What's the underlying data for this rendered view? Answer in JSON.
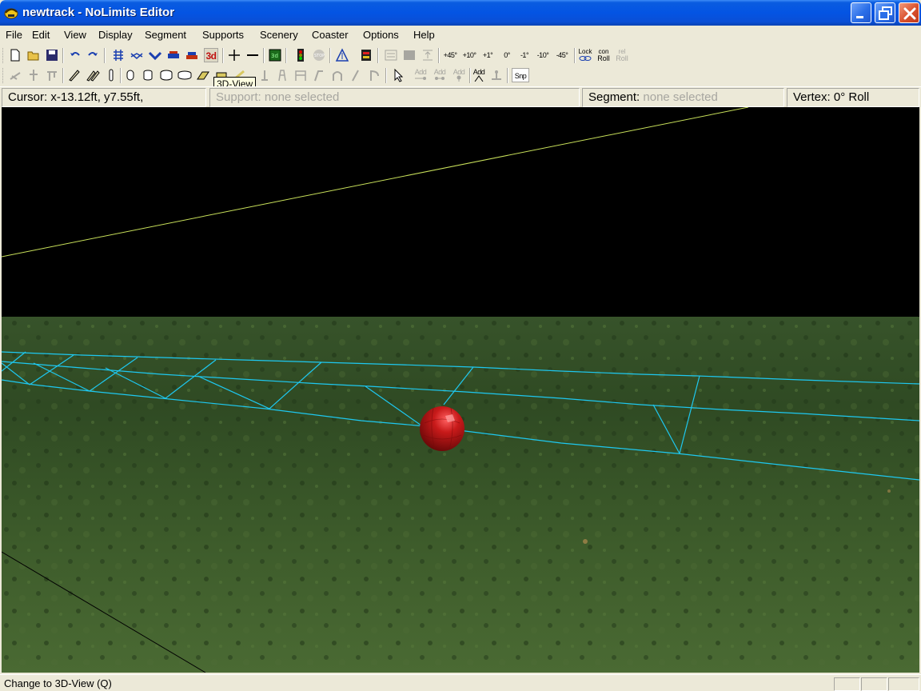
{
  "window": {
    "title": "newtrack - NoLimits Editor",
    "controls": [
      "minimize-icon",
      "maximize-icon",
      "close-icon"
    ]
  },
  "menu": {
    "items": [
      "File",
      "Edit",
      "View",
      "Display",
      "Segment",
      "Supports",
      "Scenery",
      "Coaster",
      "Options",
      "Help"
    ]
  },
  "toolbar": {
    "row1_text_buttons": {
      "plus45": "+45°",
      "plus10": "+10°",
      "plus1": "+1°",
      "zero": "0°",
      "minus1": "-1°",
      "minus10": "-10°",
      "minus45": "-45°",
      "lock_roll_top": "Lock",
      "lock_roll_bottom": "",
      "con_roll_top": "con",
      "con_roll_bottom": "Roll",
      "rel_roll_top": "rel",
      "rel_roll_bottom": "Roll",
      "three_d": "3d"
    },
    "row2_text_buttons": {
      "add1": "Add",
      "add2": "Add",
      "add3": "Add",
      "add4": "Add",
      "snap": "Snp"
    },
    "tooltip": "3D-View"
  },
  "infobar": {
    "cursor_label": "Cursor:",
    "cursor_value": "x-13.12ft, y7.55ft,",
    "support_label": "Support:",
    "support_value": "none selected",
    "segment_label": "Segment:",
    "segment_value": "none selected",
    "vertex_label": "Vertex:",
    "vertex_value": "0° Roll"
  },
  "statusbar": {
    "message": "Change to 3D-View (Q)"
  },
  "colors": {
    "title_blue": "#0454e3",
    "chrome": "#ece9d8",
    "track_wire": "#1ec8f0",
    "grid_line": "#c8e05a",
    "vertex_ball": "#b51818",
    "grass": "#3a5222",
    "sky": "#000000"
  }
}
